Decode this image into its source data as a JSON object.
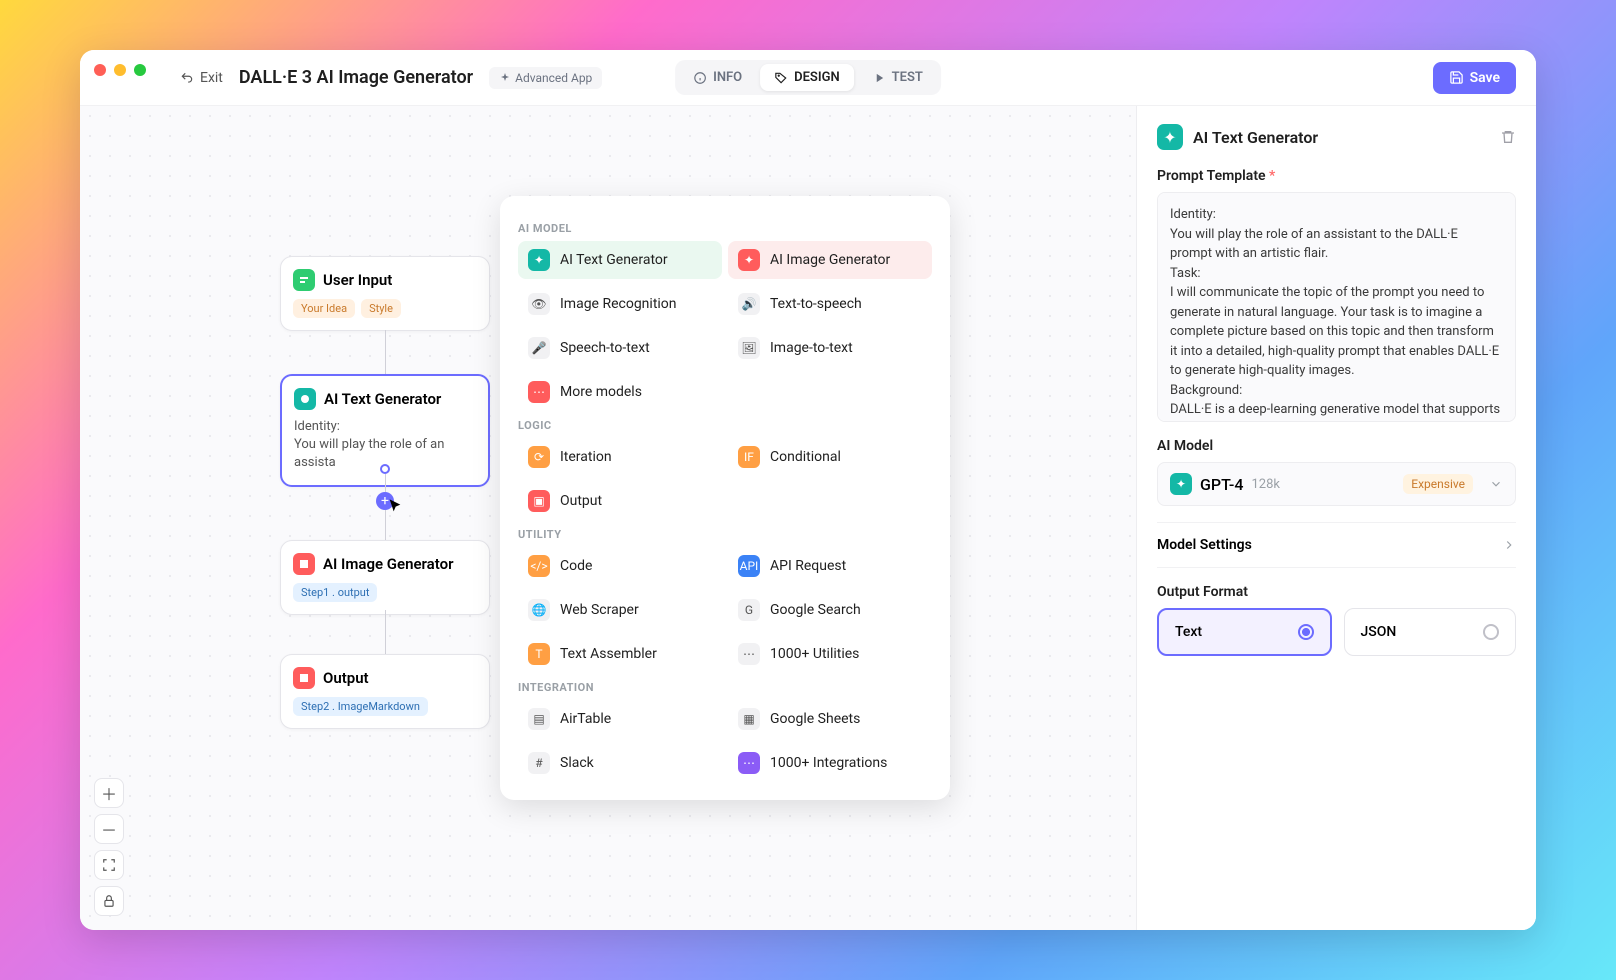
{
  "window": {
    "exit": "Exit",
    "title": "DALL·E 3 AI Image Generator",
    "badge": "Advanced App",
    "tabs": {
      "info": "INFO",
      "design": "DESIGN",
      "test": "TEST"
    },
    "save": "Save"
  },
  "canvas": {
    "nodes": {
      "user_input": {
        "title": "User Input",
        "tags": [
          "Your Idea",
          "Style"
        ]
      },
      "text_gen": {
        "title": "AI Text Generator",
        "body": "Identity:\nYou will play the role of an assista"
      },
      "image_gen": {
        "title": "AI Image Generator",
        "tag_prefix": "Step1 .",
        "tag_value": "output"
      },
      "output": {
        "title": "Output",
        "tag_prefix": "Step2 .",
        "tag_value": "ImageMarkdown"
      }
    }
  },
  "popover": {
    "sections": {
      "ai_model": "AI MODEL",
      "logic": "LOGIC",
      "utility": "UTILITY",
      "integration": "INTEGRATION"
    },
    "items": {
      "ai_text": "AI Text Generator",
      "ai_image": "AI Image Generator",
      "img_rec": "Image Recognition",
      "tts": "Text-to-speech",
      "stt": "Speech-to-text",
      "itt": "Image-to-text",
      "more_models": "More models",
      "iteration": "Iteration",
      "conditional": "Conditional",
      "output": "Output",
      "code": "Code",
      "api": "API Request",
      "scraper": "Web Scraper",
      "gsearch": "Google Search",
      "assembler": "Text Assembler",
      "utilities": "1000+ Utilities",
      "airtable": "AirTable",
      "gsheets": "Google Sheets",
      "slack": "Slack",
      "integrations": "1000+ Integrations"
    }
  },
  "panel": {
    "title": "AI Text Generator",
    "prompt_label": "Prompt Template",
    "prompt_text": "Identity:\nYou will play the role of an assistant to the DALL·E prompt with an artistic flair.\nTask:\nI will communicate the topic of the prompt you need to generate in natural language. Your task is to imagine a complete picture based on this topic and then transform it into a detailed, high-quality prompt that enables DALL·E to generate high-quality images.\nBackground:\nDALL·E is a deep-learning generative model that supports",
    "model_label": "AI Model",
    "model_name": "GPT-4",
    "model_context": "128k",
    "model_cost": "Expensive",
    "settings": "Model Settings",
    "output_label": "Output Format",
    "opt_text": "Text",
    "opt_json": "JSON"
  }
}
